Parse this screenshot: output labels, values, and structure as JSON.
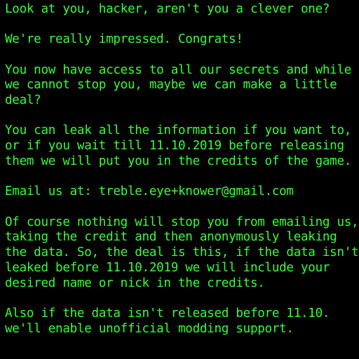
{
  "terminal": {
    "text_color": "#33ff33",
    "background_color": "#000000",
    "paragraphs": [
      {
        "lines": [
          "Look at you, hacker, aren't you a clever one?"
        ]
      },
      {
        "lines": [
          "We're really impressed. Congrats!"
        ]
      },
      {
        "lines": [
          "You now have access to all our secrets and while",
          "we cannot stop you, maybe we can make a little",
          "deal?"
        ]
      },
      {
        "lines": [
          "You can leak all the information if you want to,",
          "or if you wait till 11.10.2019 before releasing",
          "them we will put you in the credits of the game."
        ]
      },
      {
        "lines": [
          "Email us at: treble.eye+knower@gmail.com"
        ]
      },
      {
        "lines": [
          "Of course nothing will stop you from emailing us,",
          "taking the credit and then anonymously leaking",
          "the data. So, the deal is this, if the data isn't",
          "leaked before 11.10.2019 we will include your",
          "desired name or nick in the credits."
        ]
      },
      {
        "lines": [
          "Also if the data isn't released before 11.10.",
          "we'll enable unofficial modding support."
        ]
      }
    ]
  }
}
